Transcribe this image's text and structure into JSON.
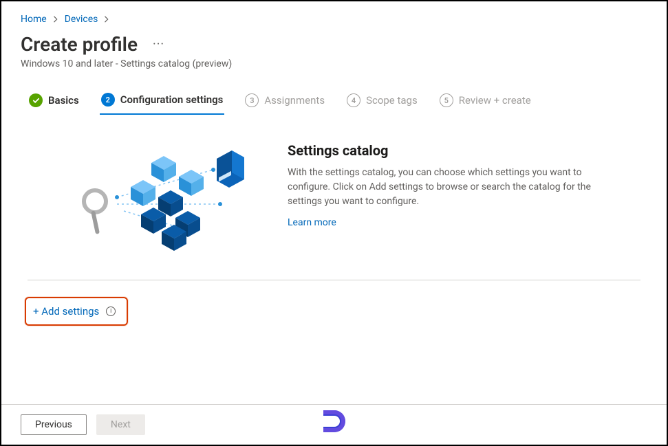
{
  "breadcrumb": {
    "home": "Home",
    "devices": "Devices"
  },
  "header": {
    "title": "Create profile",
    "subtitle": "Windows 10 and later - Settings catalog (preview)"
  },
  "wizard": {
    "step1": "Basics",
    "step2": "Configuration settings",
    "step3": "Assignments",
    "step3_num": "3",
    "step4": "Scope tags",
    "step4_num": "4",
    "step5": "Review + create",
    "step5_num": "5"
  },
  "catalog": {
    "heading": "Settings catalog",
    "body": "With the settings catalog, you can choose which settings you want to configure. Click on Add settings to browse or search the catalog for the settings you want to configure.",
    "learn": "Learn more"
  },
  "add": {
    "label": "+ Add settings"
  },
  "footer": {
    "previous": "Previous",
    "next": "Next"
  }
}
